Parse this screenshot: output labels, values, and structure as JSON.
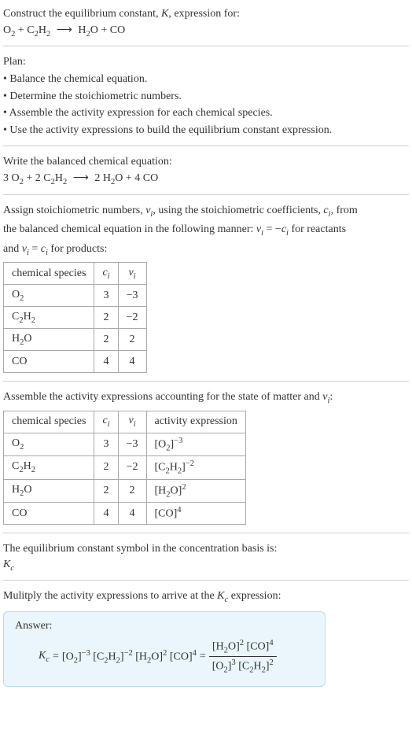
{
  "intro": {
    "line1": "Construct the equilibrium constant, ",
    "k": "K",
    "line1b": ", expression for:",
    "eq_lhs_o2": "O",
    "eq_lhs_c2h2": "C",
    "eq_rhs_h2o": "H",
    "eq_rhs_co": "CO",
    "plus": " + ",
    "arrow": "⟶"
  },
  "plan": {
    "title": "Plan:",
    "b1": "• Balance the chemical equation.",
    "b2": "• Determine the stoichiometric numbers.",
    "b3": "• Assemble the activity expression for each chemical species.",
    "b4": "• Use the activity expressions to build the equilibrium constant expression."
  },
  "balanced": {
    "title": "Write the balanced chemical equation:",
    "c_o2": "3 O",
    "c_c2h2": "2 C",
    "c_h2o": "2 H",
    "c_co": "4 CO",
    "plus": " + ",
    "arrow": "⟶"
  },
  "assign": {
    "l1a": "Assign stoichiometric numbers, ",
    "nu": "ν",
    "i": "i",
    "l1b": ", using the stoichiometric coefficients, ",
    "c": "c",
    "l1c": ", from",
    "l2a": "the balanced chemical equation in the following manner: ",
    "rel1": " = −",
    "l2b": " for reactants",
    "l3a": "and ",
    "rel2": " = ",
    "l3b": " for products:"
  },
  "table1": {
    "h1": "chemical species",
    "h2": "c",
    "h3": "ν",
    "r1s": "O",
    "r1c": "3",
    "r1n": "−3",
    "r2s": "C",
    "r2c": "2",
    "r2n": "−2",
    "r3s": "H",
    "r3c": "2",
    "r3n": "2",
    "r4s": "CO",
    "r4c": "4",
    "r4n": "4"
  },
  "assemble": {
    "l1": "Assemble the activity expressions accounting for the state of matter and ",
    "l1b": ":"
  },
  "table2": {
    "h1": "chemical species",
    "h2": "c",
    "h3": "ν",
    "h4": "activity expression",
    "r1s": "O",
    "r1c": "3",
    "r1n": "−3",
    "r2s": "C",
    "r2c": "2",
    "r2n": "−2",
    "r3s": "H",
    "r3c": "2",
    "r3n": "2",
    "r4s": "CO",
    "r4c": "4",
    "r4n": "4"
  },
  "symbol": {
    "l1": "The equilibrium constant symbol in the concentration basis is:",
    "kc_k": "K",
    "kc_c": "c"
  },
  "multiply": {
    "l1": "Mulitply the activity expressions to arrive at the ",
    "l1b": " expression:"
  },
  "answer": {
    "label": "Answer:",
    "eq": " = ",
    "neg3": "−3",
    "neg2": "−2",
    "p2": "2",
    "p4": "4",
    "p3": "3"
  }
}
